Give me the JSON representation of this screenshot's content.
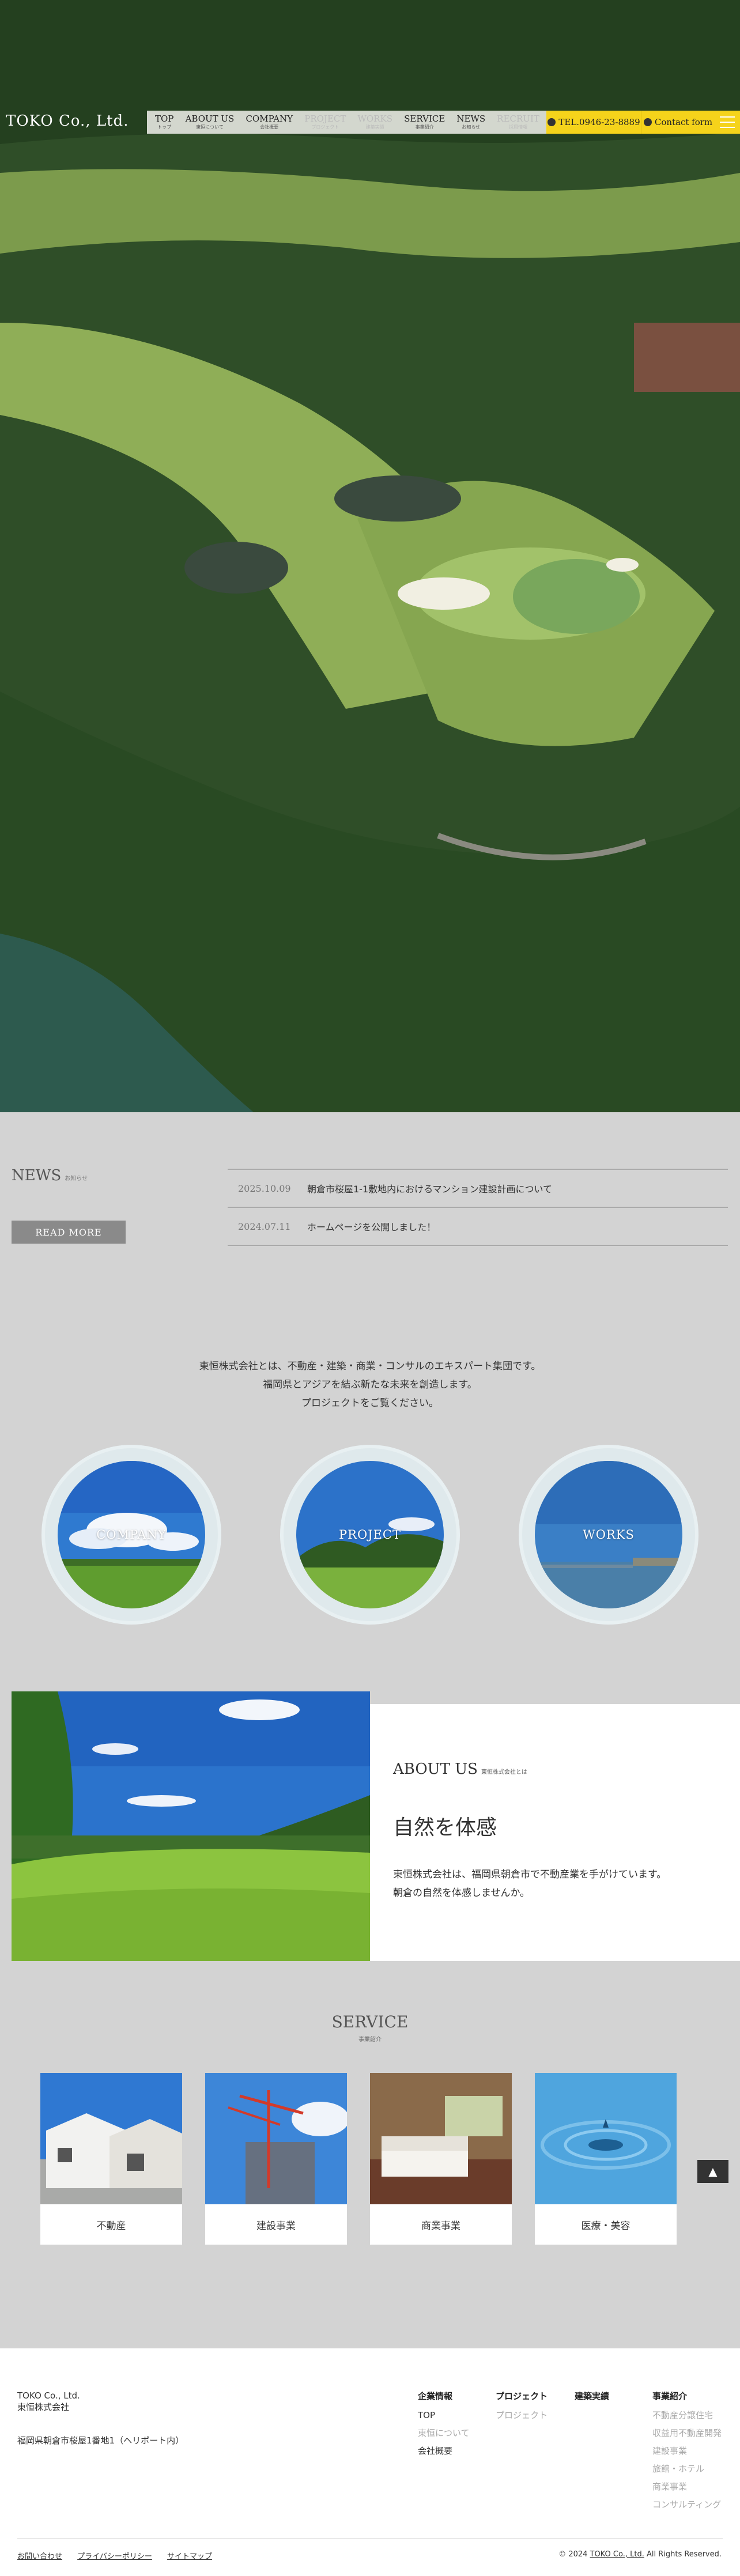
{
  "header": {
    "logo": "TOKO Co., Ltd.",
    "nav": [
      {
        "en": "TOP",
        "jp": "トップ"
      },
      {
        "en": "ABOUT US",
        "jp": "東恒について"
      },
      {
        "en": "COMPANY",
        "jp": "会社概要"
      },
      {
        "en": "PROJECT",
        "jp": "プロジェクト"
      },
      {
        "en": "WORKS",
        "jp": "建築実績"
      },
      {
        "en": "SERVICE",
        "jp": "事業紹介"
      },
      {
        "en": "NEWS",
        "jp": "お知らせ"
      },
      {
        "en": "RECRUIT",
        "jp": "採用情報"
      }
    ],
    "tel": "TEL.0946-23-8889",
    "contact": "Contact form"
  },
  "news": {
    "title": "NEWS",
    "subtitle": "お知らせ",
    "read_more": "READ MORE",
    "items": [
      {
        "date": "2025.10.09",
        "text": "朝倉市桜屋1-1敷地内におけるマンション建設計画について"
      },
      {
        "date": "2024.07.11",
        "text": "ホームページを公開しました！"
      }
    ]
  },
  "intro": {
    "lines": [
      "東恒株式会社とは、不動産・建築・商業・コンサルのエキスパート集団です。",
      "福岡県とアジアを結ぶ新たな未来を創造します。",
      "プロジェクトをご覧ください。"
    ]
  },
  "circles": [
    {
      "label": "COMPANY"
    },
    {
      "label": "PROJECT"
    },
    {
      "label": "WORKS"
    }
  ],
  "about": {
    "title": "ABOUT US",
    "subtitle": "東恒株式会社とは",
    "heading": "自然を体感",
    "body": [
      "東恒株式会社は、福岡県朝倉市で不動産業を手がけています。",
      "朝倉の自然を体感しませんか。"
    ]
  },
  "service": {
    "title": "SERVICE",
    "subtitle": "事業紹介",
    "cards": [
      "不動産",
      "建設事業",
      "商業事業",
      "医療・美容"
    ]
  },
  "to_top": "▲",
  "footer": {
    "company_en": "TOKO Co., Ltd.",
    "company_jp": "東恒株式会社",
    "address": "福岡県朝倉市桜屋1番地1（ヘリポート内）",
    "columns": [
      {
        "heading": "企業情報",
        "items": [
          {
            "text": "TOP",
            "dim": false
          },
          {
            "text": "東恒について",
            "dim": true
          },
          {
            "text": "会社概要",
            "dim": false
          }
        ]
      },
      {
        "heading": "プロジェクト",
        "items": [
          {
            "text": "プロジェクト",
            "dim": true
          }
        ]
      },
      {
        "heading": "建築実績",
        "items": []
      },
      {
        "heading": "事業紹介",
        "items": [
          {
            "text": "不動産分譲住宅",
            "dim": true
          },
          {
            "text": "収益用不動産開発",
            "dim": true
          },
          {
            "text": "建設事業",
            "dim": true
          },
          {
            "text": "旅館・ホテル",
            "dim": true
          },
          {
            "text": "商業事業",
            "dim": true
          },
          {
            "text": "コンサルティング",
            "dim": true
          }
        ]
      }
    ],
    "links": [
      "お問い合わせ",
      "プライバシーポリシー",
      "サイトマップ"
    ],
    "copyright_pre": "© 2024 ",
    "copyright_link": "TOKO Co., Ltd.",
    "copyright_post": " All Rights Reserved."
  }
}
